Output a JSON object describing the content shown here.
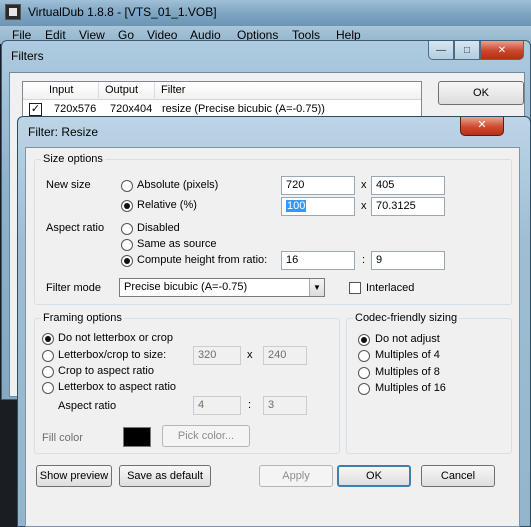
{
  "main_window": {
    "title": "VirtualDub 1.8.8 - [VTS_01_1.VOB]",
    "menu": [
      "File",
      "Edit",
      "View",
      "Go",
      "Video",
      "Audio",
      "Options",
      "Tools",
      "Help"
    ]
  },
  "filters_dialog": {
    "title": "Filters",
    "columns": [
      "Input",
      "Output",
      "Filter"
    ],
    "rows": [
      {
        "enabled": true,
        "input": "720x576",
        "output": "720x404",
        "filter": "resize (Precise bicubic (A=-0.75))"
      }
    ],
    "ok_label": "OK",
    "window_buttons": [
      "—",
      "□",
      "✕"
    ]
  },
  "resize_dialog": {
    "title": "Filter: Resize",
    "close_glyph": "✕",
    "size_options": {
      "group_label": "Size options",
      "new_size_label": "New size",
      "absolute_label": "Absolute (pixels)",
      "absolute_width": "720",
      "absolute_height": "405",
      "relative_label": "Relative (%)",
      "relative_width": "100",
      "relative_height": "70.3125",
      "times": "x",
      "selected_mode": "relative",
      "aspect_ratio_label": "Aspect ratio",
      "disabled_label": "Disabled",
      "same_as_source_label": "Same as source",
      "compute_height_label": "Compute height from ratio:",
      "aspect_mode": "compute_height",
      "ratio_num": "16",
      "ratio_colon": ":",
      "ratio_den": "9",
      "filter_mode_label": "Filter mode",
      "filter_mode_value": "Precise bicubic (A=-0.75)",
      "interlaced_label": "Interlaced",
      "interlaced": false
    },
    "framing_options": {
      "group_label": "Framing options",
      "opt_none": "Do not letterbox or crop",
      "opt_letterbox_size": "Letterbox/crop to size:",
      "size_w": "320",
      "size_x": "x",
      "size_h": "240",
      "opt_crop_aspect": "Crop to aspect ratio",
      "opt_letterbox_aspect": "Letterbox to aspect ratio",
      "aspect_label": "Aspect ratio",
      "aspect_w": "4",
      "aspect_colon": ":",
      "aspect_h": "3",
      "fill_color_label": "Fill color",
      "fill_color": "#000000",
      "pick_color_label": "Pick color...",
      "selected": "none"
    },
    "codec_sizing": {
      "group_label": "Codec-friendly sizing",
      "opt_none": "Do not adjust",
      "opt_4": "Multiples of 4",
      "opt_8": "Multiples of 8",
      "opt_16": "Multiples of 16",
      "selected": "none"
    },
    "buttons": {
      "show_preview": "Show preview",
      "save_default": "Save as default",
      "apply": "Apply",
      "ok": "OK",
      "cancel": "Cancel"
    }
  },
  "colors": {
    "aero_frame": "#93b5cc",
    "dialog_bg": "#f0f0f0",
    "close_red": "#c9452c",
    "selection": "#3399ff"
  }
}
